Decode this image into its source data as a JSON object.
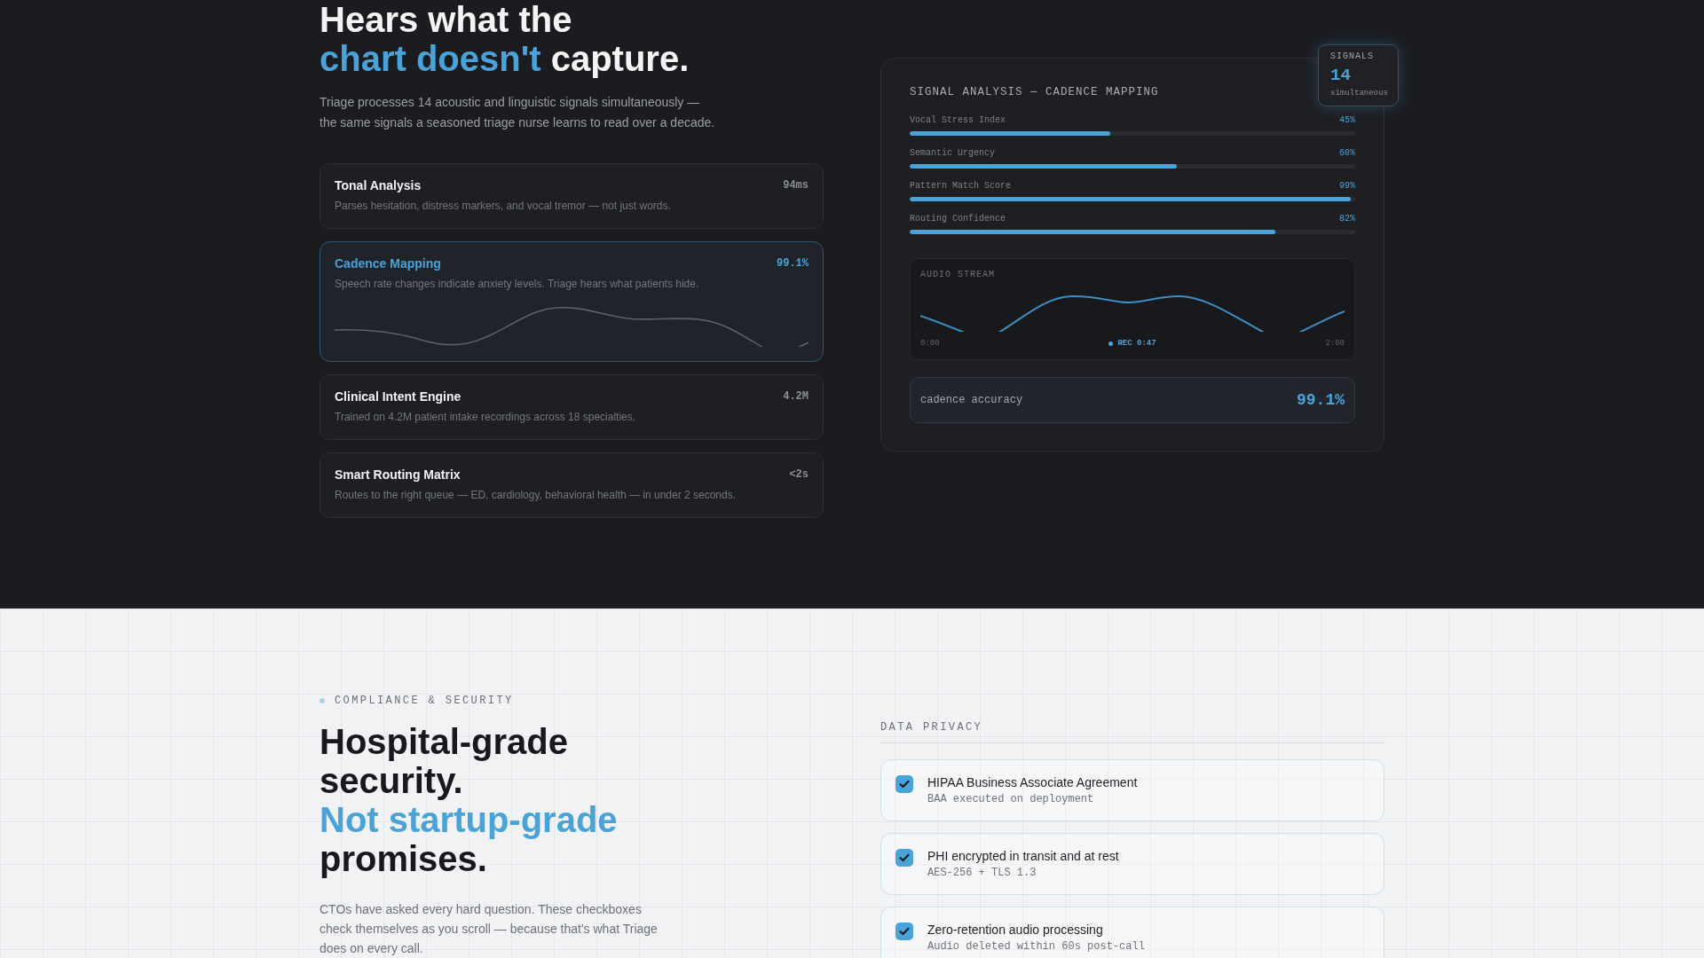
{
  "hero": {
    "title_lines": [
      {
        "parts": [
          {
            "text": "Hears what the",
            "accent": false
          }
        ]
      },
      {
        "parts": [
          {
            "text": "chart doesn't",
            "accent": true
          },
          {
            "text": "capture.",
            "accent": false
          }
        ]
      }
    ],
    "intro": "Triage processes 14 acoustic and linguistic signals simultaneously — the same signals a seasoned triage nurse learns to read over a decade."
  },
  "features": [
    {
      "title": "Tonal Analysis",
      "description": "Parses hesitation, distress markers, and vocal tremor — not just words.",
      "metric": "94ms",
      "selected": false
    },
    {
      "title": "Cadence Mapping",
      "description": "Speech rate changes indicate anxiety levels. Triage hears what patients hide.",
      "metric": "99.1%",
      "selected": true
    },
    {
      "title": "Clinical Intent Engine",
      "description": "Trained on 4.2M patient intake recordings across 18 specialties.",
      "metric": "4.2M",
      "selected": false
    },
    {
      "title": "Smart Routing Matrix",
      "description": "Routes to the right queue — ED, cardiology, behavioral health — in under 2 seconds.",
      "metric": "<2s",
      "selected": false
    }
  ],
  "analysis_panel": {
    "title": "SIGNAL ANALYSIS — CADENCE MAPPING",
    "badge": {
      "label": "SIGNALS",
      "value": "14",
      "caption": "simultaneous"
    },
    "signals": [
      {
        "name": "Vocal Stress Index",
        "level": 0.45,
        "reading": "45%"
      },
      {
        "name": "Semantic Urgency",
        "level": 0.6,
        "reading": "60%"
      },
      {
        "name": "Pattern Match Score",
        "level": 0.99,
        "reading": "99%"
      },
      {
        "name": "Routing Confidence",
        "level": 0.82,
        "reading": "82%"
      }
    ],
    "audio_stream": {
      "label": "AUDIO STREAM",
      "start": "0:00",
      "recording": "REC 0:47",
      "end": "2:00"
    },
    "accuracy": {
      "label": "cadence accuracy",
      "value": "99.1%"
    }
  },
  "compliance": {
    "eyebrow": "COMPLIANCE & SECURITY",
    "title_lines": [
      {
        "parts": [
          {
            "text": "Hospital-grade",
            "accent": false
          }
        ]
      },
      {
        "parts": [
          {
            "text": "security.",
            "accent": false
          }
        ]
      },
      {
        "parts": [
          {
            "text": "Not startup-grade",
            "accent": true
          }
        ]
      },
      {
        "parts": [
          {
            "text": "promises.",
            "accent": false
          }
        ]
      }
    ],
    "body": "CTOs have asked every hard question. These checkboxes check themselves as you scroll — because that's what Triage does on every call."
  },
  "privacy": {
    "heading": "DATA PRIVACY",
    "items": [
      {
        "title": "HIPAA Business Associate Agreement",
        "detail": "BAA executed on deployment",
        "checked": true
      },
      {
        "title": "PHI encrypted in transit and at rest",
        "detail": "AES-256 + TLS 1.3",
        "checked": true
      },
      {
        "title": "Zero-retention audio processing",
        "detail": "Audio deleted within 60s post-call",
        "checked": true
      }
    ]
  }
}
